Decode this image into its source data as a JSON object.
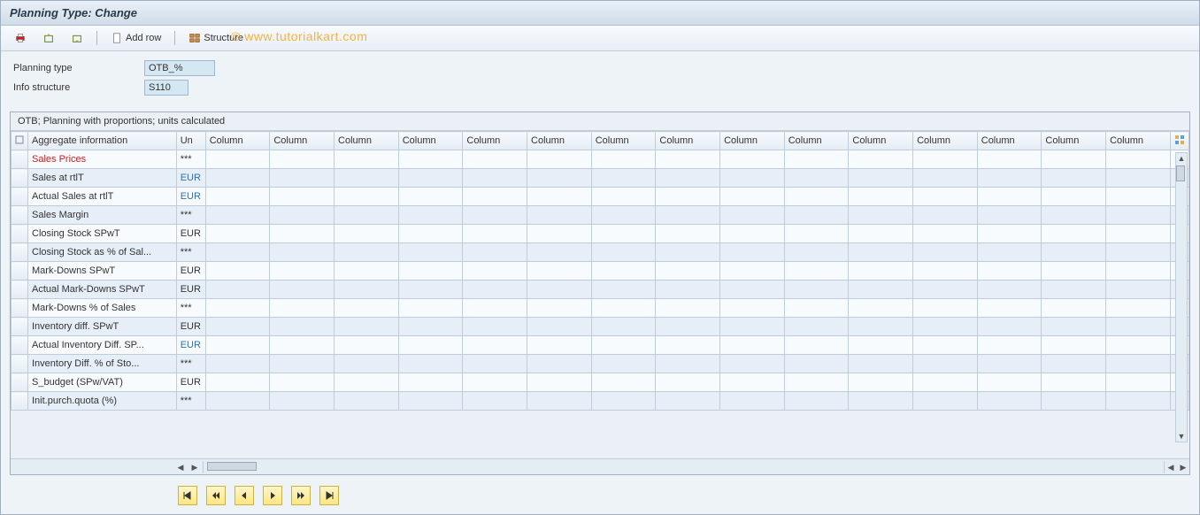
{
  "title": "Planning Type: Change",
  "toolbar": {
    "add_row": "Add row",
    "structure": "Structure"
  },
  "watermark": "© www.tutorialkart.com",
  "form": {
    "planning_type_label": "Planning type",
    "planning_type_value": "OTB_%",
    "info_structure_label": "Info structure",
    "info_structure_value": "S110"
  },
  "grid": {
    "title": "OTB; Planning with proportions; units calculated",
    "header": {
      "select": "",
      "aggregate": "Aggregate information",
      "unit": "Un",
      "column": "Column"
    },
    "column_count": 15,
    "rows": [
      {
        "label": "Sales Prices",
        "unit": "***",
        "highlight": true
      },
      {
        "label": "Sales at rtlT",
        "unit": "EUR",
        "unit_link": true
      },
      {
        "label": "Actual Sales at rtlT",
        "unit": "EUR",
        "unit_link": true
      },
      {
        "label": "Sales Margin",
        "unit": "***"
      },
      {
        "label": "Closing Stock SPwT",
        "unit": "EUR"
      },
      {
        "label": "Closing Stock as % of Sal...",
        "unit": "***"
      },
      {
        "label": "Mark-Downs SPwT",
        "unit": "EUR"
      },
      {
        "label": "Actual Mark-Downs SPwT",
        "unit": "EUR"
      },
      {
        "label": "Mark-Downs % of Sales",
        "unit": "***"
      },
      {
        "label": "Inventory diff. SPwT",
        "unit": "EUR"
      },
      {
        "label": "Actual Inventory Diff. SP...",
        "unit": "EUR",
        "unit_link": true
      },
      {
        "label": "Inventory Diff. % of Sto...",
        "unit": "***"
      },
      {
        "label": "S_budget (SPw/VAT)",
        "unit": "EUR"
      },
      {
        "label": "Init.purch.quota (%)",
        "unit": "***"
      }
    ]
  }
}
